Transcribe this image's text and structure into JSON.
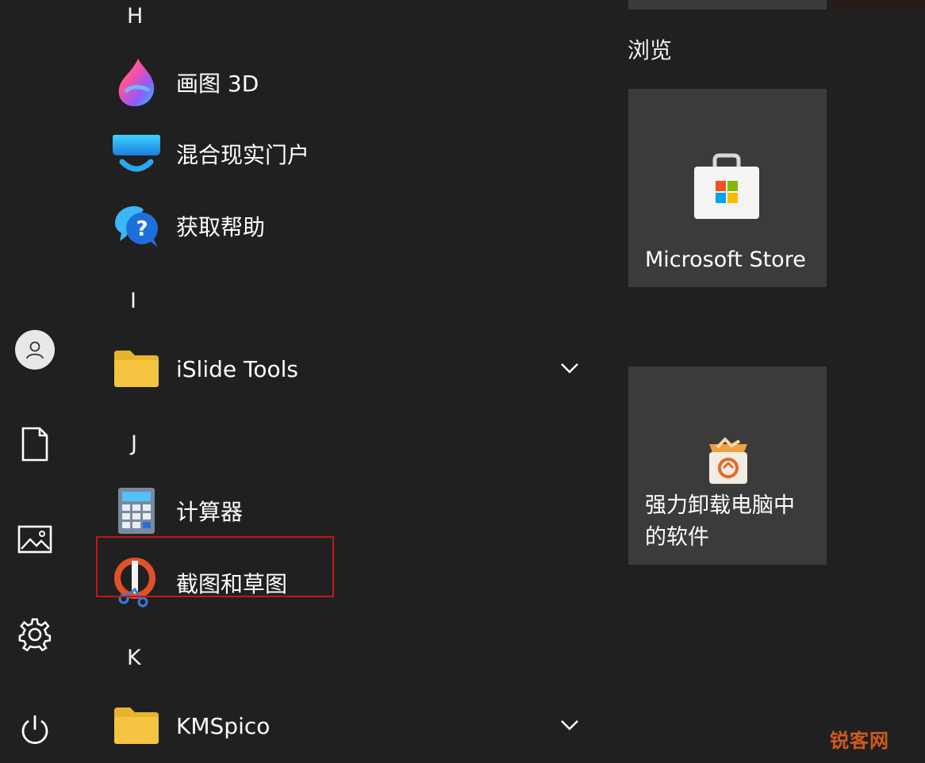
{
  "sections": [
    {
      "letter": "H"
    },
    {
      "letter": "I"
    },
    {
      "letter": "J"
    },
    {
      "letter": "K"
    }
  ],
  "apps": [
    {
      "label": "画图 3D",
      "icon": "paint3d-icon"
    },
    {
      "label": "混合现实门户",
      "icon": "mixed-reality-icon"
    },
    {
      "label": "获取帮助",
      "icon": "get-help-icon"
    },
    {
      "label": "iSlide Tools",
      "icon": "folder-icon",
      "expandable": true
    },
    {
      "label": "计算器",
      "icon": "calculator-icon"
    },
    {
      "label": "截图和草图",
      "icon": "snip-sketch-icon",
      "highlighted": true
    },
    {
      "label": "KMSpico",
      "icon": "folder-icon",
      "expandable": true
    }
  ],
  "tiles_group": {
    "title": "浏览"
  },
  "tiles": [
    {
      "label": "Microsoft Store",
      "icon": "store-bag-icon"
    },
    {
      "label": "强力卸载电脑中\n的软件",
      "line1": "强力卸载电脑中",
      "line2": "的软件",
      "icon": "uninstall-box-icon"
    }
  ],
  "watermark": "锐客网",
  "colors": {
    "background": "#202020",
    "tile": "#3b3b3b",
    "highlight": "#c81414",
    "folder": "#f5c542"
  }
}
